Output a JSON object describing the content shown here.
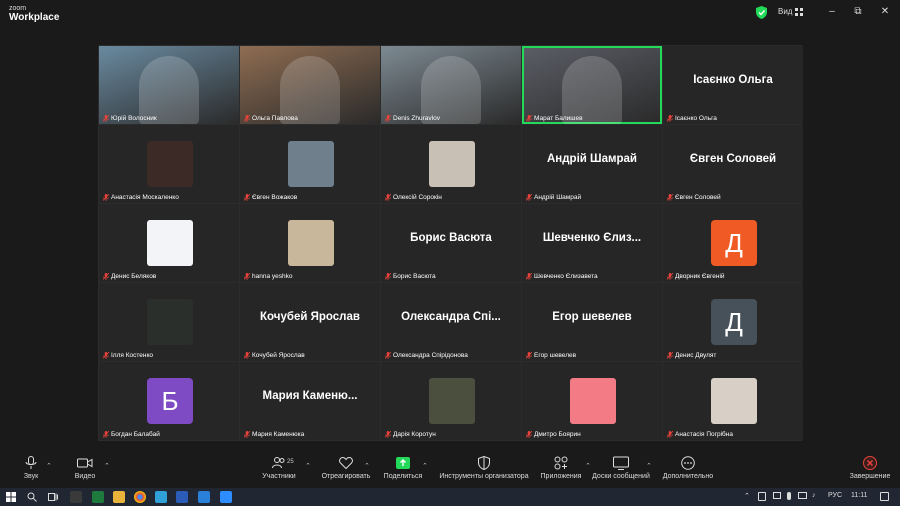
{
  "app": {
    "logo_top": "zoom",
    "logo_bottom": "Workplace",
    "view_label": "Вид"
  },
  "colors": {
    "active_speaker": "#23d959",
    "muted": "#e8433a",
    "leave": "#e8433a",
    "share": "#23d959"
  },
  "participants": [
    {
      "name": "Юрій Волосник",
      "type": "video",
      "bg": "#6a8aa0"
    },
    {
      "name": "Ольга Павлова",
      "type": "video",
      "bg": "#8f6d52"
    },
    {
      "name": "Denis Zhuravlov",
      "type": "video",
      "bg": "#7d8a92"
    },
    {
      "name": "Марат Балишев",
      "type": "video",
      "bg": "#5b5e66",
      "active": true
    },
    {
      "name": "Ісаєнко Ольга",
      "type": "name",
      "display": "Ісаєнко Ольга"
    },
    {
      "name": "Анастасія Москаленко",
      "type": "photo",
      "bg": "#3b2a25"
    },
    {
      "name": "Євген Вожаков",
      "type": "photo",
      "bg": "#6f7f8c"
    },
    {
      "name": "Олексій Сорокін",
      "type": "photo",
      "bg": "#c8c0b4"
    },
    {
      "name": "Андрій Шамрай",
      "type": "name",
      "display": "Андрій Шамрай"
    },
    {
      "name": "Євген Соловей",
      "type": "name",
      "display": "Євген Соловей"
    },
    {
      "name": "Денис Беляков",
      "type": "photo",
      "bg": "#f2f4f7"
    },
    {
      "name": "hanna yeshko",
      "type": "photo",
      "bg": "#c9b79c"
    },
    {
      "name": "Борис Васюта",
      "type": "name",
      "display": "Борис Васюта"
    },
    {
      "name": "Шевченко Єлизавета",
      "type": "name",
      "display": "Шевченко Єлиз..."
    },
    {
      "name": "Дворник Євгеній",
      "type": "letter",
      "letter": "Д",
      "bg": "#f05a24"
    },
    {
      "name": "Ілля Костенко",
      "type": "photo",
      "bg": "#2b2f2c"
    },
    {
      "name": "Кочубей Ярослав",
      "type": "name",
      "display": "Кочубей Ярослав"
    },
    {
      "name": "Олександра Спірідонова",
      "type": "name",
      "display": "Олександра Спі..."
    },
    {
      "name": "Егор шевелев",
      "type": "name",
      "display": "Егор шевелев"
    },
    {
      "name": "Денис Двулят",
      "type": "letter",
      "letter": "Д",
      "bg": "#46515a"
    },
    {
      "name": "Богдан Балабай",
      "type": "letter",
      "letter": "Б",
      "bg": "#7f4bc4"
    },
    {
      "name": "Мария Каменюка",
      "type": "name",
      "display": "Мария Каменю..."
    },
    {
      "name": "Дарія Коротун",
      "type": "photo",
      "bg": "#4a4f3e"
    },
    {
      "name": "Дмитро Боярин",
      "type": "photo",
      "bg": "#f27b86"
    },
    {
      "name": "Анастасія Погрібна",
      "type": "photo",
      "bg": "#d8cfc6"
    }
  ],
  "toolbar": {
    "audio": "Звук",
    "video": "Видео",
    "participants": "Участники",
    "participants_count": "25",
    "react": "Отреагировать",
    "share": "Поделиться",
    "host_tools": "Инструменты организатора",
    "apps": "Приложения",
    "whiteboards": "Доски сообщений",
    "more": "Дополнительно",
    "leave": "Завершение"
  },
  "taskbar": {
    "lang": "РУС",
    "time": "11:11"
  }
}
